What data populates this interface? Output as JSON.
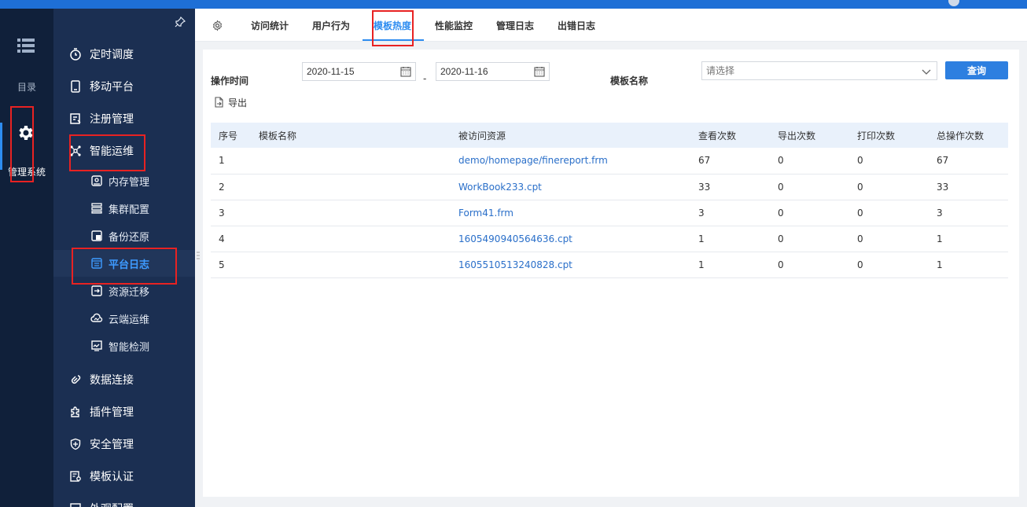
{
  "rail": {
    "catalog_label": "目录",
    "system_label": "管理系统"
  },
  "sidenav": {
    "items": [
      {
        "label": "定时调度",
        "icon": "timer-icon"
      },
      {
        "label": "移动平台",
        "icon": "mobile-icon"
      },
      {
        "label": "注册管理",
        "icon": "register-icon"
      },
      {
        "label": "智能运维",
        "icon": "ops-icon"
      },
      {
        "label": "内存管理",
        "icon": "memory-icon"
      },
      {
        "label": "集群配置",
        "icon": "cluster-icon"
      },
      {
        "label": "备份还原",
        "icon": "backup-icon"
      },
      {
        "label": "平台日志",
        "icon": "log-icon"
      },
      {
        "label": "资源迁移",
        "icon": "migrate-icon"
      },
      {
        "label": "云端运维",
        "icon": "cloud-ops-icon"
      },
      {
        "label": "智能检测",
        "icon": "monitor-icon"
      },
      {
        "label": "数据连接",
        "icon": "link-icon"
      },
      {
        "label": "插件管理",
        "icon": "plugin-icon"
      },
      {
        "label": "安全管理",
        "icon": "shield-icon"
      },
      {
        "label": "模板认证",
        "icon": "template-cert-icon"
      },
      {
        "label": "外观配置",
        "icon": "appearance-icon"
      }
    ]
  },
  "tabs": [
    {
      "label": "访问统计"
    },
    {
      "label": "用户行为"
    },
    {
      "label": "模板热度"
    },
    {
      "label": "性能监控"
    },
    {
      "label": "管理日志"
    },
    {
      "label": "出错日志"
    }
  ],
  "filters": {
    "time_label": "操作时间",
    "start_date": "2020-11-15",
    "separator": "-",
    "end_date": "2020-11-16",
    "template_label": "模板名称",
    "template_placeholder": "请选择",
    "query_label": "查询",
    "export_label": "导出"
  },
  "table": {
    "headers": [
      "序号",
      "模板名称",
      "被访问资源",
      "查看次数",
      "导出次数",
      "打印次数",
      "总操作次数"
    ],
    "rows": [
      {
        "no": "1",
        "name": "",
        "resource": "demo/homepage/finereport.frm",
        "views": "67",
        "exports": "0",
        "prints": "0",
        "total": "67"
      },
      {
        "no": "2",
        "name": "",
        "resource": "WorkBook233.cpt",
        "views": "33",
        "exports": "0",
        "prints": "0",
        "total": "33"
      },
      {
        "no": "3",
        "name": "",
        "resource": "Form41.frm",
        "views": "3",
        "exports": "0",
        "prints": "0",
        "total": "3"
      },
      {
        "no": "4",
        "name": "",
        "resource": "1605490940564636.cpt",
        "views": "1",
        "exports": "0",
        "prints": "0",
        "total": "1"
      },
      {
        "no": "5",
        "name": "",
        "resource": "1605510513240828.cpt",
        "views": "1",
        "exports": "0",
        "prints": "0",
        "total": "1"
      }
    ]
  },
  "colors": {
    "accent": "#2d8cf0",
    "highlight": "#e82222",
    "sidebar": "#1b2f52",
    "rail": "#10203a"
  }
}
